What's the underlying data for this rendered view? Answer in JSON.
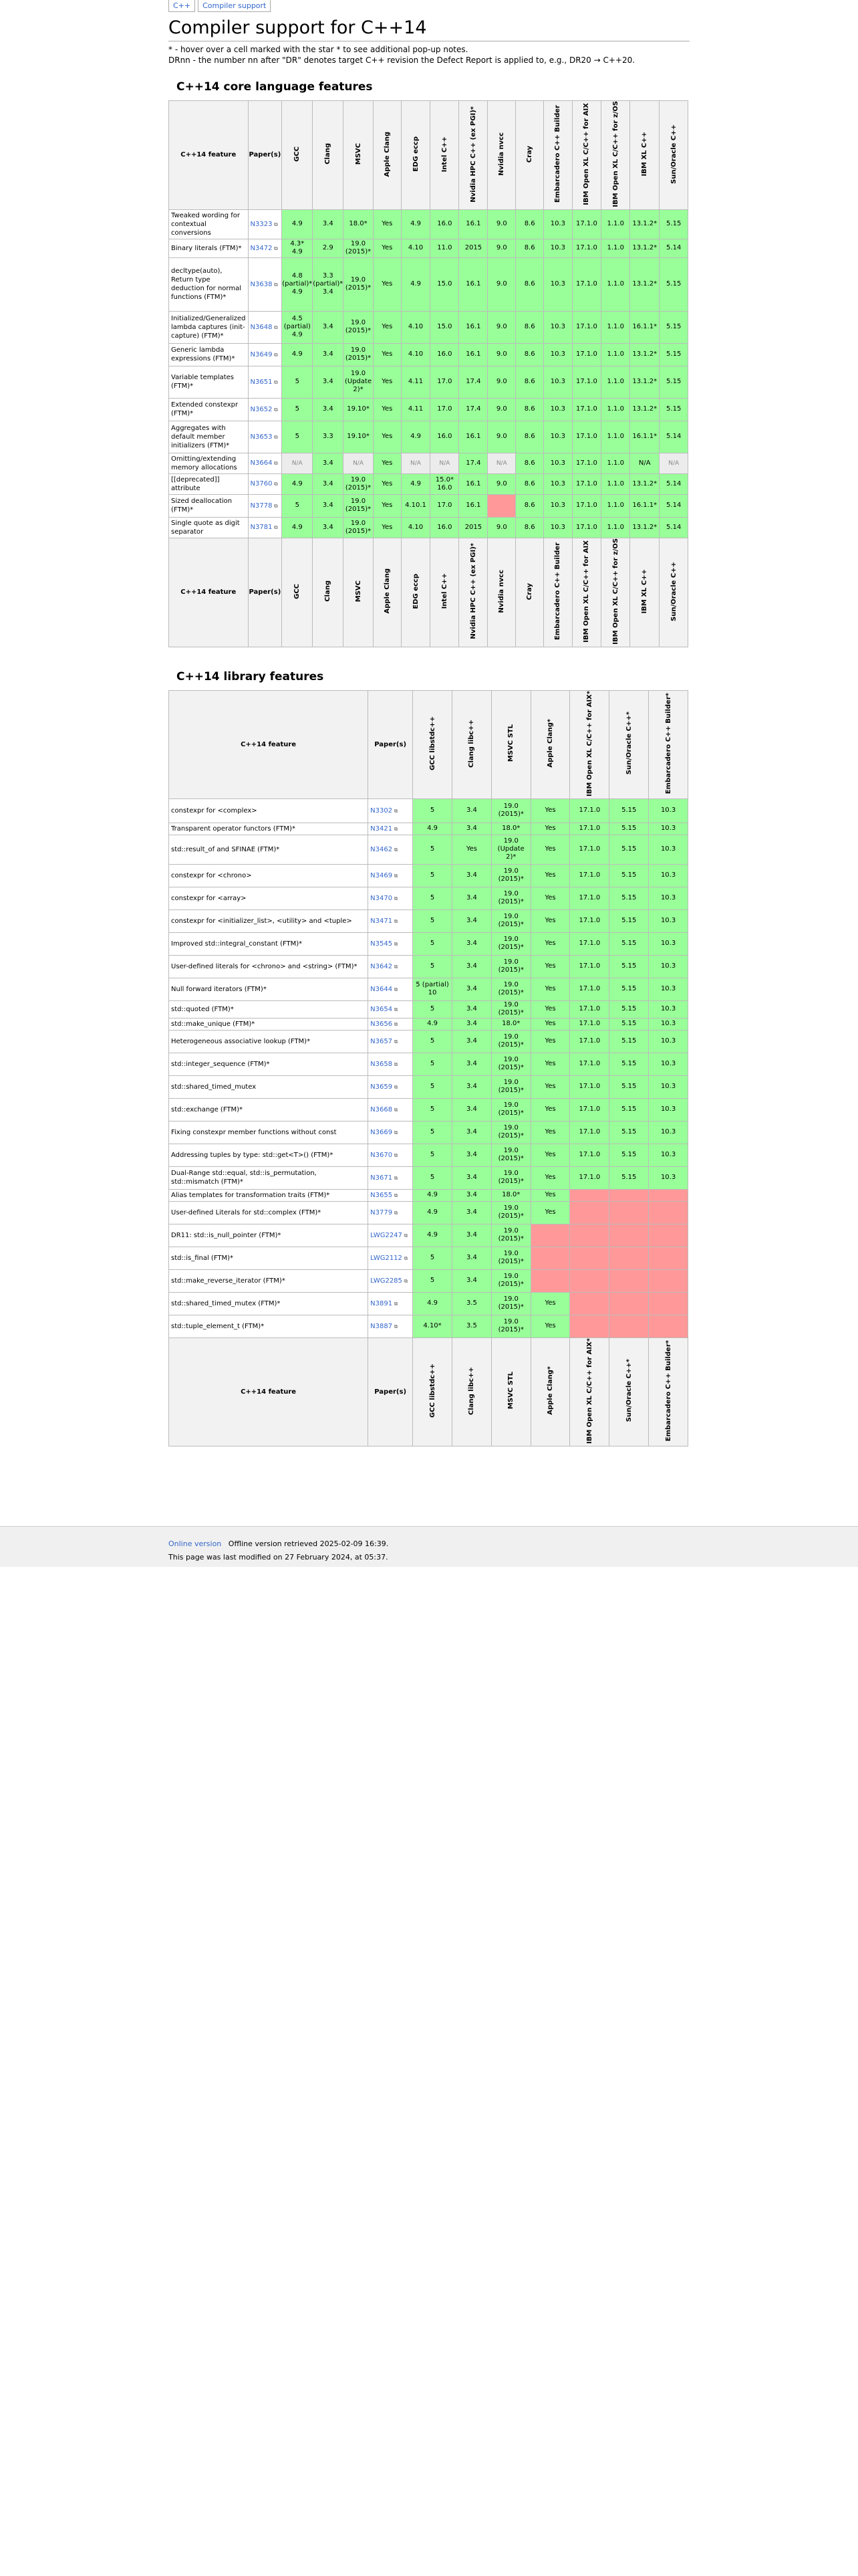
{
  "crumbs": [
    "C++",
    "Compiler support"
  ],
  "title": "Compiler support for C++14",
  "notes": [
    "* - hover over a cell marked with the star * to see additional pop-up notes.",
    "DRnn - the number nn after \"DR\" denotes target C++ revision the Defect Report is applied to, e.g., DR20 → C++20."
  ],
  "core": {
    "heading": "C++14 core language features",
    "feature_header": "C++14 feature",
    "paper_header": "Paper(s)",
    "columns": [
      "GCC",
      "Clang",
      "MSVC",
      "Apple Clang",
      "EDG eccp",
      "Intel C++",
      "Nvidia HPC C++ (ex PGI)*",
      "Nvidia nvcc",
      "Cray",
      "Embarcadero C++ Builder",
      "IBM Open XL C/C++ for AIX",
      "IBM Open XL C/C++ for z/OS",
      "IBM XL C++",
      "Sun/Oracle C++"
    ],
    "rows": [
      {
        "name": "Tweaked wording for contextual conversions",
        "paper": "N3323",
        "cells": [
          "4.9",
          "3.4",
          "18.0*",
          "Yes",
          "4.9",
          "16.0",
          "16.1",
          "9.0",
          "8.6",
          "10.3",
          "17.1.0",
          "1.1.0",
          "13.1.2*",
          "5.15"
        ],
        "cls": "ggggggggggggggg"
      },
      {
        "name": "Binary literals (FTM)*",
        "paper": "N3472",
        "cells": [
          "4.3*\n4.9",
          "2.9",
          "19.0\n(2015)*",
          "Yes",
          "4.10",
          "11.0",
          "2015",
          "9.0",
          "8.6",
          "10.3",
          "17.1.0",
          "1.1.0",
          "13.1.2*",
          "5.14"
        ],
        "cls": "ggggggggggggggg"
      },
      {
        "name": "decltype(auto), Return type deduction for normal functions (FTM)*",
        "paper": "N3638",
        "cells": [
          "4.8\n(partial)*\n4.9",
          "3.3\n(partial)*\n3.4",
          "19.0\n(2015)*",
          "Yes",
          "4.9",
          "15.0",
          "16.1",
          "9.0",
          "8.6",
          "10.3",
          "17.1.0",
          "1.1.0",
          "13.1.2*",
          "5.15"
        ],
        "cls": "ggggggggggggggg"
      },
      {
        "name": "Initialized/Generalized lambda captures (init-capture) (FTM)*",
        "paper": "N3648",
        "cells": [
          "4.5\n(partial)\n4.9",
          "3.4",
          "19.0\n(2015)*",
          "Yes",
          "4.10",
          "15.0",
          "16.1",
          "9.0",
          "8.6",
          "10.3",
          "17.1.0",
          "1.1.0",
          "16.1.1*",
          "5.15"
        ],
        "cls": "ggggggggggggggg"
      },
      {
        "name": "Generic lambda expressions (FTM)*",
        "paper": "N3649",
        "cells": [
          "4.9",
          "3.4",
          "19.0\n(2015)*",
          "Yes",
          "4.10",
          "16.0",
          "16.1",
          "9.0",
          "8.6",
          "10.3",
          "17.1.0",
          "1.1.0",
          "13.1.2*",
          "5.15"
        ],
        "cls": "ggggggggggggggg"
      },
      {
        "name": "Variable templates (FTM)*",
        "paper": "N3651",
        "cells": [
          "5",
          "3.4",
          "19.0\n(Update\n2)*",
          "Yes",
          "4.11",
          "17.0",
          "17.4",
          "9.0",
          "8.6",
          "10.3",
          "17.1.0",
          "1.1.0",
          "13.1.2*",
          "5.15"
        ],
        "cls": "ggggggggggggggg"
      },
      {
        "name": "Extended constexpr (FTM)*",
        "paper": "N3652",
        "cells": [
          "5",
          "3.4",
          "19.10*",
          "Yes",
          "4.11",
          "17.0",
          "17.4",
          "9.0",
          "8.6",
          "10.3",
          "17.1.0",
          "1.1.0",
          "13.1.2*",
          "5.15"
        ],
        "cls": "ggggggggggggggg"
      },
      {
        "name": "Aggregates with default member initializers (FTM)*",
        "paper": "N3653",
        "cells": [
          "5",
          "3.3",
          "19.10*",
          "Yes",
          "4.9",
          "16.0",
          "16.1",
          "9.0",
          "8.6",
          "10.3",
          "17.1.0",
          "1.1.0",
          "16.1.1*",
          "5.14"
        ],
        "cls": "ggggggggggggggg"
      },
      {
        "name": "Omitting/extending memory allocations",
        "paper": "N3664",
        "cells": [
          "N/A",
          "3.4",
          "N/A",
          "Yes",
          "N/A",
          "N/A",
          "17.4",
          "N/A",
          "8.6",
          "10.3",
          "17.1.0",
          "1.1.0",
          "N/A",
          "N/A"
        ],
        "cls": "ngngnngngggggnn"
      },
      {
        "name": "[[deprecated]] attribute",
        "paper": "N3760",
        "cells": [
          "4.9",
          "3.4",
          "19.0\n(2015)*",
          "Yes",
          "4.9",
          "15.0*\n16.0",
          "16.1",
          "9.0",
          "8.6",
          "10.3",
          "17.1.0",
          "1.1.0",
          "13.1.2*",
          "5.14"
        ],
        "cls": "ggggggggggggggg"
      },
      {
        "name": "Sized deallocation (FTM)*",
        "paper": "N3778",
        "cells": [
          "5",
          "3.4",
          "19.0\n(2015)*",
          "Yes",
          "4.10.1",
          "17.0",
          "16.1",
          "",
          "8.6",
          "10.3",
          "17.1.0",
          "1.1.0",
          "16.1.1*",
          "5.14"
        ],
        "cls": "gggggggrgggggg"
      },
      {
        "name": "Single quote as digit separator",
        "paper": "N3781",
        "cells": [
          "4.9",
          "3.4",
          "19.0\n(2015)*",
          "Yes",
          "4.10",
          "16.0",
          "2015",
          "9.0",
          "8.6",
          "10.3",
          "17.1.0",
          "1.1.0",
          "13.1.2*",
          "5.14"
        ],
        "cls": "ggggggggggggggg"
      }
    ]
  },
  "lib": {
    "heading": "C++14 library features",
    "feature_header": "C++14 feature",
    "paper_header": "Paper(s)",
    "columns": [
      "GCC libstdc++",
      "Clang libc++",
      "MSVC STL",
      "Apple Clang*",
      "IBM Open XL C/C++ for AIX*",
      "Sun/Oracle C++*",
      "Embarcadero C++ Builder*"
    ],
    "rows": [
      {
        "name": "constexpr for <complex>",
        "paper": "N3302",
        "cells": [
          "5",
          "3.4",
          "19.0\n(2015)*",
          "Yes",
          "17.1.0",
          "5.15",
          "10.3"
        ],
        "cls": "ggggggg"
      },
      {
        "name": "Transparent operator functors (FTM)*",
        "paper": "N3421",
        "cells": [
          "4.9",
          "3.4",
          "18.0*",
          "Yes",
          "17.1.0",
          "5.15",
          "10.3"
        ],
        "cls": "ggggggg"
      },
      {
        "name": "std::result_of and SFINAE (FTM)*",
        "paper": "N3462",
        "cells": [
          "5",
          "Yes",
          "19.0\n(Update\n2)*",
          "Yes",
          "17.1.0",
          "5.15",
          "10.3"
        ],
        "cls": "ggggggg"
      },
      {
        "name": "constexpr for <chrono>",
        "paper": "N3469",
        "cells": [
          "5",
          "3.4",
          "19.0\n(2015)*",
          "Yes",
          "17.1.0",
          "5.15",
          "10.3"
        ],
        "cls": "ggggggg"
      },
      {
        "name": "constexpr for <array>",
        "paper": "N3470",
        "cells": [
          "5",
          "3.4",
          "19.0\n(2015)*",
          "Yes",
          "17.1.0",
          "5.15",
          "10.3"
        ],
        "cls": "ggggggg"
      },
      {
        "name": "constexpr for <initializer_list>, <utility> and <tuple>",
        "paper": "N3471",
        "cells": [
          "5",
          "3.4",
          "19.0\n(2015)*",
          "Yes",
          "17.1.0",
          "5.15",
          "10.3"
        ],
        "cls": "ggggggg"
      },
      {
        "name": "Improved std::integral_constant (FTM)*",
        "paper": "N3545",
        "cells": [
          "5",
          "3.4",
          "19.0\n(2015)*",
          "Yes",
          "17.1.0",
          "5.15",
          "10.3"
        ],
        "cls": "ggggggg"
      },
      {
        "name": "User-defined literals for <chrono> and <string> (FTM)*",
        "paper": "N3642",
        "cells": [
          "5",
          "3.4",
          "19.0\n(2015)*",
          "Yes",
          "17.1.0",
          "5.15",
          "10.3"
        ],
        "cls": "ggggggg"
      },
      {
        "name": "Null forward iterators (FTM)*",
        "paper": "N3644",
        "cells": [
          "5 (partial)\n10",
          "3.4",
          "19.0\n(2015)*",
          "Yes",
          "17.1.0",
          "5.15",
          "10.3"
        ],
        "cls": "ggggggg"
      },
      {
        "name": "std::quoted (FTM)*",
        "paper": "N3654",
        "cells": [
          "5",
          "3.4",
          "19.0\n(2015)*",
          "Yes",
          "17.1.0",
          "5.15",
          "10.3"
        ],
        "cls": "ggggggg"
      },
      {
        "name": "std::make_unique (FTM)*",
        "paper": "N3656",
        "cells": [
          "4.9",
          "3.4",
          "18.0*",
          "Yes",
          "17.1.0",
          "5.15",
          "10.3"
        ],
        "cls": "ggggggg"
      },
      {
        "name": "Heterogeneous associative lookup (FTM)*",
        "paper": "N3657",
        "cells": [
          "5",
          "3.4",
          "19.0\n(2015)*",
          "Yes",
          "17.1.0",
          "5.15",
          "10.3"
        ],
        "cls": "ggggggg"
      },
      {
        "name": "std::integer_sequence (FTM)*",
        "paper": "N3658",
        "cells": [
          "5",
          "3.4",
          "19.0\n(2015)*",
          "Yes",
          "17.1.0",
          "5.15",
          "10.3"
        ],
        "cls": "ggggggg"
      },
      {
        "name": "std::shared_timed_mutex",
        "paper": "N3659",
        "cells": [
          "5",
          "3.4",
          "19.0\n(2015)*",
          "Yes",
          "17.1.0",
          "5.15",
          "10.3"
        ],
        "cls": "ggggggg"
      },
      {
        "name": "std::exchange (FTM)*",
        "paper": "N3668",
        "cells": [
          "5",
          "3.4",
          "19.0\n(2015)*",
          "Yes",
          "17.1.0",
          "5.15",
          "10.3"
        ],
        "cls": "ggggggg"
      },
      {
        "name": "Fixing constexpr member functions without const",
        "paper": "N3669",
        "cells": [
          "5",
          "3.4",
          "19.0\n(2015)*",
          "Yes",
          "17.1.0",
          "5.15",
          "10.3"
        ],
        "cls": "ggggggg"
      },
      {
        "name": "Addressing tuples by type: std::get<T>() (FTM)*",
        "paper": "N3670",
        "cells": [
          "5",
          "3.4",
          "19.0\n(2015)*",
          "Yes",
          "17.1.0",
          "5.15",
          "10.3"
        ],
        "cls": "ggggggg"
      },
      {
        "name": "Dual-Range std::equal, std::is_permutation, std::mismatch (FTM)*",
        "paper": "N3671",
        "cells": [
          "5",
          "3.4",
          "19.0\n(2015)*",
          "Yes",
          "17.1.0",
          "5.15",
          "10.3"
        ],
        "cls": "ggggggg"
      },
      {
        "name": "Alias templates for transformation traits (FTM)*",
        "paper": "N3655",
        "cells": [
          "4.9",
          "3.4",
          "18.0*",
          "Yes",
          "",
          "",
          ""
        ],
        "cls": "ggggrrr"
      },
      {
        "name": "User-defined Literals for std::complex (FTM)*",
        "paper": "N3779",
        "cells": [
          "4.9",
          "3.4",
          "19.0\n(2015)*",
          "Yes",
          "",
          "",
          ""
        ],
        "cls": "ggggrrr"
      },
      {
        "name": "DR11: std::is_null_pointer (FTM)*",
        "paper": "LWG2247",
        "cells": [
          "4.9",
          "3.4",
          "19.0\n(2015)*",
          "",
          "",
          "",
          ""
        ],
        "cls": "gggrrrr"
      },
      {
        "name": "std::is_final (FTM)*",
        "paper": "LWG2112",
        "cells": [
          "5",
          "3.4",
          "19.0\n(2015)*",
          "",
          "",
          "",
          ""
        ],
        "cls": "gggrrrr"
      },
      {
        "name": "std::make_reverse_iterator (FTM)*",
        "paper": "LWG2285",
        "cells": [
          "5",
          "3.4",
          "19.0\n(2015)*",
          "",
          "",
          "",
          ""
        ],
        "cls": "gggrrrr"
      },
      {
        "name": "std::shared_timed_mutex (FTM)*",
        "paper": "N3891",
        "cells": [
          "4.9",
          "3.5",
          "19.0\n(2015)*",
          "Yes",
          "",
          "",
          ""
        ],
        "cls": "ggggrrr"
      },
      {
        "name": "std::tuple_element_t (FTM)*",
        "paper": "N3887",
        "cells": [
          "4.10*",
          "3.5",
          "19.0\n(2015)*",
          "Yes",
          "",
          "",
          ""
        ],
        "cls": "ggggrrr"
      }
    ]
  },
  "footer": {
    "link": "Online version",
    "retrieved": "Offline version retrieved 2025-02-09 16:39.",
    "modified": "This page was last modified on 27 February 2024, at 05:37."
  }
}
